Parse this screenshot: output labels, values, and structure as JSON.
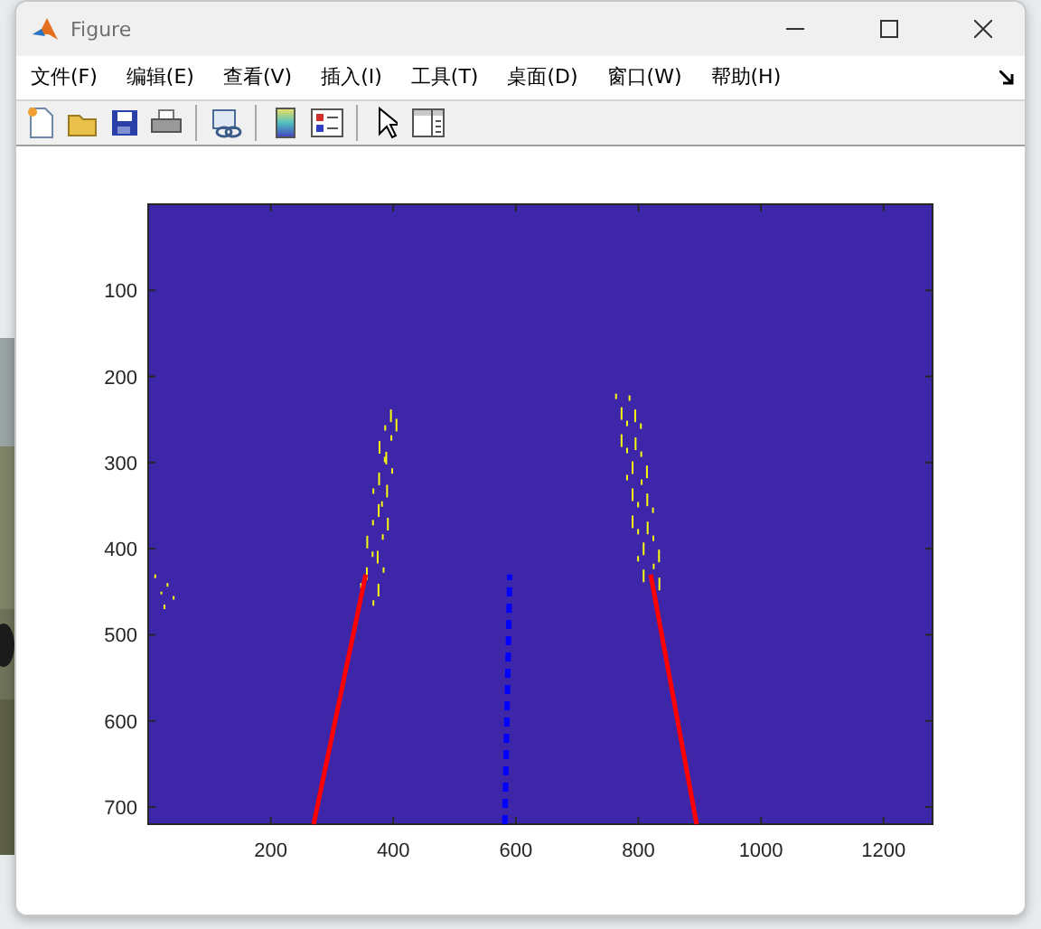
{
  "window": {
    "title": "Figure"
  },
  "menu": [
    "文件(F)",
    "编辑(E)",
    "查看(V)",
    "插入(I)",
    "工具(T)",
    "桌面(D)",
    "窗口(W)",
    "帮助(H)"
  ],
  "figure": {
    "chart_data": {
      "type": "line",
      "xlim": [
        0,
        1280
      ],
      "ylim": [
        720,
        0
      ],
      "x": [
        270,
        355,
        582,
        590,
        820,
        895
      ],
      "series": [
        {
          "color": "#ff0000",
          "values": [
            720,
            430,
            null,
            null,
            null,
            null
          ]
        },
        {
          "color": "#0000ff",
          "line_style": "dashed",
          "values": [
            null,
            null,
            720,
            430,
            null,
            null
          ]
        },
        {
          "color": "#ff0000",
          "values": [
            null,
            null,
            null,
            null,
            430,
            720
          ]
        }
      ],
      "xticks": [
        {
          "value": 200,
          "label": "200"
        },
        {
          "value": 400,
          "label": "400"
        },
        {
          "value": 600,
          "label": "600"
        },
        {
          "value": 800,
          "label": "800"
        },
        {
          "value": 1000,
          "label": "1000"
        },
        {
          "value": 1200,
          "label": "1200"
        }
      ],
      "yticks": [
        {
          "value": 100,
          "label": "100"
        },
        {
          "value": 200,
          "label": "200"
        },
        {
          "value": 300,
          "label": "300"
        },
        {
          "value": 400,
          "label": "400"
        },
        {
          "value": 500,
          "label": "500"
        },
        {
          "value": 600,
          "label": "600"
        },
        {
          "value": 700,
          "label": "700"
        }
      ]
    }
  }
}
